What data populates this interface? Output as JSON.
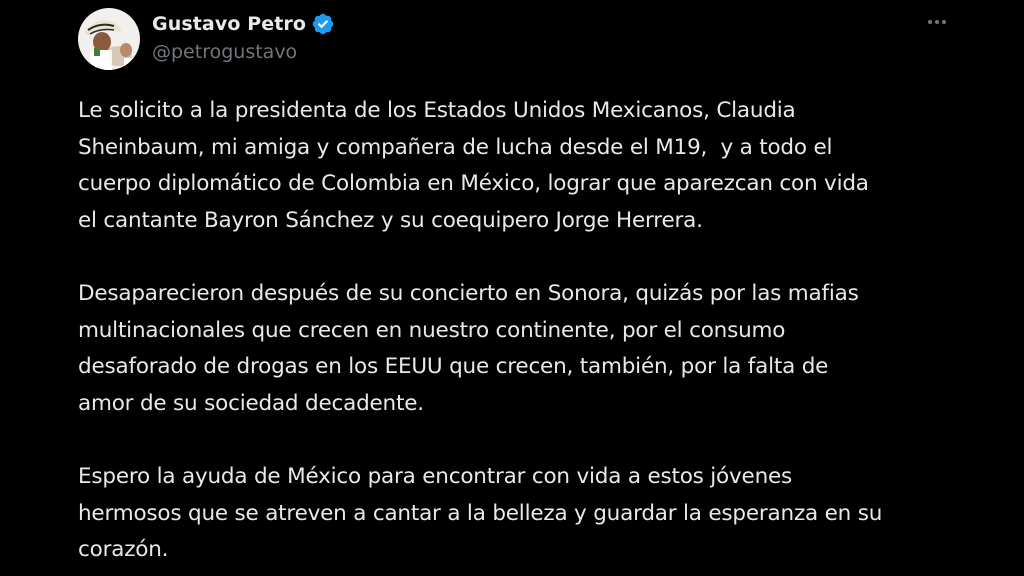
{
  "author": {
    "display_name": "Gustavo Petro",
    "handle": "@petrogustavo",
    "verified": true,
    "verified_color": "#1d9bf0"
  },
  "menu": {
    "icon": "more-horizontal-icon"
  },
  "tweet": {
    "paragraphs": [
      "Le solicito a la presidenta de los Estados Unidos Mexicanos, Claudia\nSheinbaum, mi amiga y compañera de lucha desde el M19,  y a todo el\ncuerpo diplomático de Colombia en México, lograr que aparezcan con vida\nel cantante Bayron Sánchez y su coequipero Jorge Herrera.",
      "Desaparecieron después de su concierto en Sonora, quizás por las mafias\nmultinacionales que crecen en nuestro continente, por el consumo\ndesaforado de drogas en los EEUU que crecen, también, por la falta de\namor de su sociedad decadente.",
      "Espero la ayuda de México para encontrar con vida a estos jóvenes\nhermosos que se atreven a cantar a la belleza y guardar la esperanza en su\ncorazón."
    ]
  },
  "colors": {
    "background": "#000000",
    "text": "#e7e9ea",
    "secondary_text": "#71767b"
  }
}
